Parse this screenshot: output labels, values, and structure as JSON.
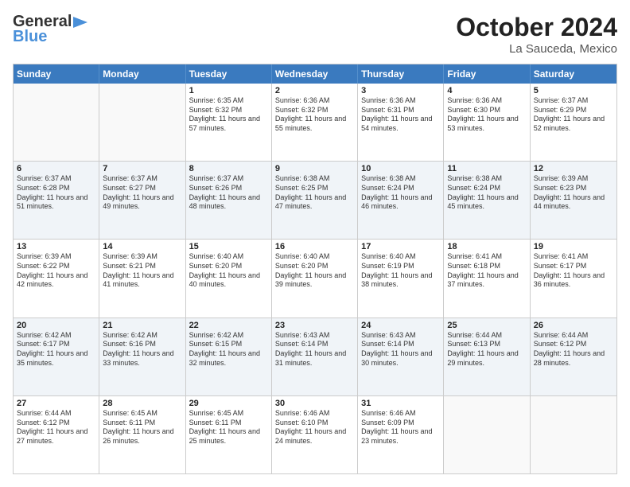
{
  "logo": {
    "line1": "General",
    "line2": "Blue",
    "arrow": true
  },
  "header": {
    "month": "October 2024",
    "location": "La Sauceda, Mexico"
  },
  "days_of_week": [
    "Sunday",
    "Monday",
    "Tuesday",
    "Wednesday",
    "Thursday",
    "Friday",
    "Saturday"
  ],
  "rows": [
    [
      {
        "day": "",
        "sunrise": "",
        "sunset": "",
        "daylight": "",
        "empty": true
      },
      {
        "day": "",
        "sunrise": "",
        "sunset": "",
        "daylight": "",
        "empty": true
      },
      {
        "day": "1",
        "sunrise": "Sunrise: 6:35 AM",
        "sunset": "Sunset: 6:32 PM",
        "daylight": "Daylight: 11 hours and 57 minutes."
      },
      {
        "day": "2",
        "sunrise": "Sunrise: 6:36 AM",
        "sunset": "Sunset: 6:32 PM",
        "daylight": "Daylight: 11 hours and 55 minutes."
      },
      {
        "day": "3",
        "sunrise": "Sunrise: 6:36 AM",
        "sunset": "Sunset: 6:31 PM",
        "daylight": "Daylight: 11 hours and 54 minutes."
      },
      {
        "day": "4",
        "sunrise": "Sunrise: 6:36 AM",
        "sunset": "Sunset: 6:30 PM",
        "daylight": "Daylight: 11 hours and 53 minutes."
      },
      {
        "day": "5",
        "sunrise": "Sunrise: 6:37 AM",
        "sunset": "Sunset: 6:29 PM",
        "daylight": "Daylight: 11 hours and 52 minutes."
      }
    ],
    [
      {
        "day": "6",
        "sunrise": "Sunrise: 6:37 AM",
        "sunset": "Sunset: 6:28 PM",
        "daylight": "Daylight: 11 hours and 51 minutes."
      },
      {
        "day": "7",
        "sunrise": "Sunrise: 6:37 AM",
        "sunset": "Sunset: 6:27 PM",
        "daylight": "Daylight: 11 hours and 49 minutes."
      },
      {
        "day": "8",
        "sunrise": "Sunrise: 6:37 AM",
        "sunset": "Sunset: 6:26 PM",
        "daylight": "Daylight: 11 hours and 48 minutes."
      },
      {
        "day": "9",
        "sunrise": "Sunrise: 6:38 AM",
        "sunset": "Sunset: 6:25 PM",
        "daylight": "Daylight: 11 hours and 47 minutes."
      },
      {
        "day": "10",
        "sunrise": "Sunrise: 6:38 AM",
        "sunset": "Sunset: 6:24 PM",
        "daylight": "Daylight: 11 hours and 46 minutes."
      },
      {
        "day": "11",
        "sunrise": "Sunrise: 6:38 AM",
        "sunset": "Sunset: 6:24 PM",
        "daylight": "Daylight: 11 hours and 45 minutes."
      },
      {
        "day": "12",
        "sunrise": "Sunrise: 6:39 AM",
        "sunset": "Sunset: 6:23 PM",
        "daylight": "Daylight: 11 hours and 44 minutes."
      }
    ],
    [
      {
        "day": "13",
        "sunrise": "Sunrise: 6:39 AM",
        "sunset": "Sunset: 6:22 PM",
        "daylight": "Daylight: 11 hours and 42 minutes."
      },
      {
        "day": "14",
        "sunrise": "Sunrise: 6:39 AM",
        "sunset": "Sunset: 6:21 PM",
        "daylight": "Daylight: 11 hours and 41 minutes."
      },
      {
        "day": "15",
        "sunrise": "Sunrise: 6:40 AM",
        "sunset": "Sunset: 6:20 PM",
        "daylight": "Daylight: 11 hours and 40 minutes."
      },
      {
        "day": "16",
        "sunrise": "Sunrise: 6:40 AM",
        "sunset": "Sunset: 6:20 PM",
        "daylight": "Daylight: 11 hours and 39 minutes."
      },
      {
        "day": "17",
        "sunrise": "Sunrise: 6:40 AM",
        "sunset": "Sunset: 6:19 PM",
        "daylight": "Daylight: 11 hours and 38 minutes."
      },
      {
        "day": "18",
        "sunrise": "Sunrise: 6:41 AM",
        "sunset": "Sunset: 6:18 PM",
        "daylight": "Daylight: 11 hours and 37 minutes."
      },
      {
        "day": "19",
        "sunrise": "Sunrise: 6:41 AM",
        "sunset": "Sunset: 6:17 PM",
        "daylight": "Daylight: 11 hours and 36 minutes."
      }
    ],
    [
      {
        "day": "20",
        "sunrise": "Sunrise: 6:42 AM",
        "sunset": "Sunset: 6:17 PM",
        "daylight": "Daylight: 11 hours and 35 minutes."
      },
      {
        "day": "21",
        "sunrise": "Sunrise: 6:42 AM",
        "sunset": "Sunset: 6:16 PM",
        "daylight": "Daylight: 11 hours and 33 minutes."
      },
      {
        "day": "22",
        "sunrise": "Sunrise: 6:42 AM",
        "sunset": "Sunset: 6:15 PM",
        "daylight": "Daylight: 11 hours and 32 minutes."
      },
      {
        "day": "23",
        "sunrise": "Sunrise: 6:43 AM",
        "sunset": "Sunset: 6:14 PM",
        "daylight": "Daylight: 11 hours and 31 minutes."
      },
      {
        "day": "24",
        "sunrise": "Sunrise: 6:43 AM",
        "sunset": "Sunset: 6:14 PM",
        "daylight": "Daylight: 11 hours and 30 minutes."
      },
      {
        "day": "25",
        "sunrise": "Sunrise: 6:44 AM",
        "sunset": "Sunset: 6:13 PM",
        "daylight": "Daylight: 11 hours and 29 minutes."
      },
      {
        "day": "26",
        "sunrise": "Sunrise: 6:44 AM",
        "sunset": "Sunset: 6:12 PM",
        "daylight": "Daylight: 11 hours and 28 minutes."
      }
    ],
    [
      {
        "day": "27",
        "sunrise": "Sunrise: 6:44 AM",
        "sunset": "Sunset: 6:12 PM",
        "daylight": "Daylight: 11 hours and 27 minutes."
      },
      {
        "day": "28",
        "sunrise": "Sunrise: 6:45 AM",
        "sunset": "Sunset: 6:11 PM",
        "daylight": "Daylight: 11 hours and 26 minutes."
      },
      {
        "day": "29",
        "sunrise": "Sunrise: 6:45 AM",
        "sunset": "Sunset: 6:11 PM",
        "daylight": "Daylight: 11 hours and 25 minutes."
      },
      {
        "day": "30",
        "sunrise": "Sunrise: 6:46 AM",
        "sunset": "Sunset: 6:10 PM",
        "daylight": "Daylight: 11 hours and 24 minutes."
      },
      {
        "day": "31",
        "sunrise": "Sunrise: 6:46 AM",
        "sunset": "Sunset: 6:09 PM",
        "daylight": "Daylight: 11 hours and 23 minutes."
      },
      {
        "day": "",
        "sunrise": "",
        "sunset": "",
        "daylight": "",
        "empty": true
      },
      {
        "day": "",
        "sunrise": "",
        "sunset": "",
        "daylight": "",
        "empty": true
      }
    ]
  ]
}
